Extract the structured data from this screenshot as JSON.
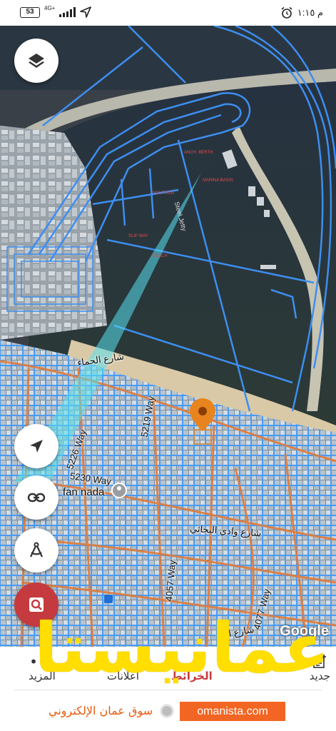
{
  "status_bar": {
    "battery": "53",
    "network": "4G+",
    "time": "م ١:١٥"
  },
  "map": {
    "streets": {
      "jetty": "Steel Jetty",
      "way_5219": "5219 Way",
      "way_5226": "5226 Way",
      "way_5230": "5230 Way",
      "way_4057": "4057 Way",
      "way_4077": "4077 Way",
      "arabic_top": "شارع الحماء",
      "arabic_mid": "شارع وادي البحاثي",
      "arabic_bottom": "شارع الخ",
      "place": "fan nada"
    },
    "google_logo": "Google",
    "colors": {
      "parcel_blue": "#3d8ef0",
      "road_orange": "#e07a3a",
      "cyan_beam": "#56e0f0",
      "pin_orange": "#e8841d",
      "fab_red": "#c53a3e"
    }
  },
  "controls": {
    "layers_icon": "layers-icon",
    "locate_icon": "navigation-arrow-icon",
    "link_icon": "link-icon",
    "compass_icon": "drafting-compass-icon",
    "search_icon": "magnify-parcel-icon"
  },
  "bottom_bar": {
    "tab_new": "جديد",
    "tab_new_icon": "add-note-icon",
    "tab_center": "الخرائط",
    "tab_mid": "اعلانات",
    "tab_more": "المزيد"
  },
  "watermark": {
    "text": "عمانيستا",
    "color": "#ffde00"
  },
  "footer": {
    "tagline": "سوق عمان الإلكتروني",
    "brand": "omanista.com",
    "brand_color": "#f26522"
  }
}
